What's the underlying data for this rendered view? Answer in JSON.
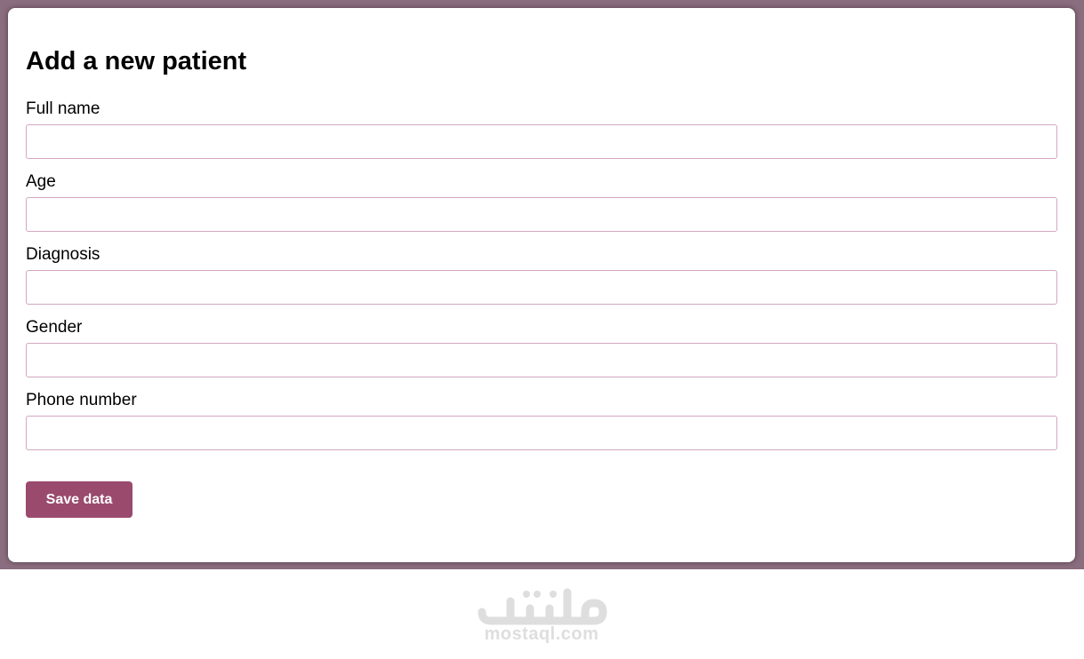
{
  "form": {
    "title": "Add a new patient",
    "fields": [
      {
        "label": "Full name",
        "value": "",
        "placeholder": ""
      },
      {
        "label": "Age",
        "value": "",
        "placeholder": ""
      },
      {
        "label": "Diagnosis",
        "value": "",
        "placeholder": ""
      },
      {
        "label": "Gender",
        "value": "",
        "placeholder": ""
      },
      {
        "label": "Phone number",
        "value": "",
        "placeholder": ""
      }
    ],
    "save_label": "Save data"
  },
  "watermark": {
    "logo_text": "مستقل",
    "url": "mostaql.com"
  },
  "colors": {
    "backdrop": "#8a6d7e",
    "card": "#ffffff",
    "input_border": "#d3a6c3",
    "button": "#9a4a6d",
    "button_text": "#ffffff",
    "watermark": "#dedede"
  }
}
